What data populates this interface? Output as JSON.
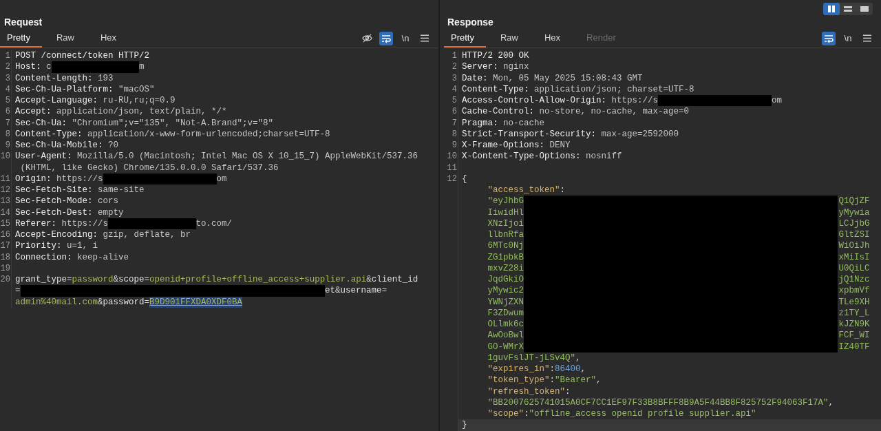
{
  "panels": [
    {
      "title": "Request",
      "tabs": [
        {
          "label": "Pretty",
          "selected": true,
          "disabled": false
        },
        {
          "label": "Raw",
          "selected": false,
          "disabled": false
        },
        {
          "label": "Hex",
          "selected": false,
          "disabled": false
        }
      ],
      "toolbar": [
        {
          "kind": "hide",
          "active": false
        },
        {
          "kind": "wrap",
          "active": true
        },
        {
          "kind": "newline",
          "label": "\\n",
          "active": false
        },
        {
          "kind": "menu",
          "active": false
        }
      ],
      "lines": [
        {
          "n": "1",
          "rows": [
            {
              "current": false,
              "indent": false,
              "segs": [
                {
                  "kind": "start",
                  "text": "POST /connect/token HTTP/2"
                }
              ]
            }
          ]
        },
        {
          "n": "2",
          "rows": [
            {
              "current": false,
              "indent": false,
              "segs": [
                {
                  "kind": "name",
                  "text": "Host: "
                },
                {
                  "kind": "val",
                  "text": "c"
                },
                {
                  "kind": "redacted"
                },
                {
                  "kind": "val",
                  "text": "m"
                }
              ]
            }
          ]
        },
        {
          "n": "3",
          "rows": [
            {
              "current": false,
              "indent": false,
              "segs": [
                {
                  "kind": "name",
                  "text": "Content-Length: "
                },
                {
                  "kind": "val",
                  "text": "193"
                }
              ]
            }
          ]
        },
        {
          "n": "4",
          "rows": [
            {
              "current": false,
              "indent": false,
              "segs": [
                {
                  "kind": "name",
                  "text": "Sec-Ch-Ua-Platform: "
                },
                {
                  "kind": "val",
                  "text": "\"macOS\""
                }
              ]
            }
          ]
        },
        {
          "n": "5",
          "rows": [
            {
              "current": false,
              "indent": false,
              "segs": [
                {
                  "kind": "name",
                  "text": "Accept-Language: "
                },
                {
                  "kind": "val",
                  "text": "ru-RU,ru;q=0.9"
                }
              ]
            }
          ]
        },
        {
          "n": "6",
          "rows": [
            {
              "current": false,
              "indent": false,
              "segs": [
                {
                  "kind": "name",
                  "text": "Accept: "
                },
                {
                  "kind": "val",
                  "text": "application/json, text/plain, */*"
                }
              ]
            }
          ]
        },
        {
          "n": "7",
          "rows": [
            {
              "current": false,
              "indent": false,
              "segs": [
                {
                  "kind": "name",
                  "text": "Sec-Ch-Ua: "
                },
                {
                  "kind": "val",
                  "text": "\"Chromium\";v=\"135\", \"Not-A.Brand\";v=\"8\""
                }
              ]
            }
          ]
        },
        {
          "n": "8",
          "rows": [
            {
              "current": false,
              "indent": false,
              "segs": [
                {
                  "kind": "name",
                  "text": "Content-Type: "
                },
                {
                  "kind": "val",
                  "text": "application/x-www-form-urlencoded;charset=UTF-8"
                }
              ]
            }
          ]
        },
        {
          "n": "9",
          "rows": [
            {
              "current": false,
              "indent": false,
              "segs": [
                {
                  "kind": "name",
                  "text": "Sec-Ch-Ua-Mobile: "
                },
                {
                  "kind": "val",
                  "text": "?0"
                }
              ]
            }
          ]
        },
        {
          "n": "10",
          "rows": [
            {
              "current": false,
              "indent": false,
              "segs": [
                {
                  "kind": "name",
                  "text": "User-Agent: "
                },
                {
                  "kind": "val",
                  "text": "Mozilla/5.0 (Macintosh; Intel Mac OS X 10_15_7) AppleWebKit/537.36"
                }
              ]
            },
            {
              "current": false,
              "indent": false,
              "segs": [
                {
                  "kind": "val",
                  "text": " (KHTML, like Gecko) Chrome/135.0.0.0 Safari/537.36"
                }
              ]
            }
          ]
        },
        {
          "n": "11",
          "rows": [
            {
              "current": false,
              "indent": false,
              "segs": [
                {
                  "kind": "name",
                  "text": "Origin: "
                },
                {
                  "kind": "val",
                  "text": "https://s"
                },
                {
                  "kind": "redacted"
                },
                {
                  "kind": "val",
                  "text": "om"
                }
              ]
            }
          ]
        },
        {
          "n": "12",
          "rows": [
            {
              "current": false,
              "indent": false,
              "segs": [
                {
                  "kind": "name",
                  "text": "Sec-Fetch-Site: "
                },
                {
                  "kind": "val",
                  "text": "same-site"
                }
              ]
            }
          ]
        },
        {
          "n": "13",
          "rows": [
            {
              "current": false,
              "indent": false,
              "segs": [
                {
                  "kind": "name",
                  "text": "Sec-Fetch-Mode: "
                },
                {
                  "kind": "val",
                  "text": "cors"
                }
              ]
            }
          ]
        },
        {
          "n": "14",
          "rows": [
            {
              "current": false,
              "indent": false,
              "segs": [
                {
                  "kind": "name",
                  "text": "Sec-Fetch-Dest: "
                },
                {
                  "kind": "val",
                  "text": "empty"
                }
              ]
            }
          ]
        },
        {
          "n": "15",
          "rows": [
            {
              "current": false,
              "indent": false,
              "segs": [
                {
                  "kind": "name",
                  "text": "Referer: "
                },
                {
                  "kind": "val",
                  "text": "https://s"
                },
                {
                  "kind": "redacted"
                },
                {
                  "kind": "val",
                  "text": "to.com/"
                }
              ]
            }
          ]
        },
        {
          "n": "16",
          "rows": [
            {
              "current": false,
              "indent": false,
              "segs": [
                {
                  "kind": "name",
                  "text": "Accept-Encoding: "
                },
                {
                  "kind": "val",
                  "text": "gzip, deflate, br"
                }
              ]
            }
          ]
        },
        {
          "n": "17",
          "rows": [
            {
              "current": false,
              "indent": false,
              "segs": [
                {
                  "kind": "name",
                  "text": "Priority: "
                },
                {
                  "kind": "val",
                  "text": "u=1, i"
                }
              ]
            }
          ]
        },
        {
          "n": "18",
          "rows": [
            {
              "current": false,
              "indent": false,
              "segs": [
                {
                  "kind": "name",
                  "text": "Connection: "
                },
                {
                  "kind": "val",
                  "text": "keep-alive"
                }
              ]
            }
          ]
        },
        {
          "n": "19"
        },
        {
          "n": "20",
          "rows": [
            {
              "current": false,
              "indent": false,
              "segs": [
                {
                  "kind": "key",
                  "text": "grant_type"
                },
                {
                  "kind": "punct",
                  "text": "="
                },
                {
                  "kind": "pval",
                  "text": "password"
                },
                {
                  "kind": "punct",
                  "text": "&"
                },
                {
                  "kind": "key",
                  "text": "scope"
                },
                {
                  "kind": "punct",
                  "text": "="
                },
                {
                  "kind": "pval",
                  "text": "openid+profile+offline_access+supplier.api"
                },
                {
                  "kind": "punct",
                  "text": "&"
                },
                {
                  "kind": "key",
                  "text": "client_id"
                }
              ]
            },
            {
              "current": false,
              "indent": false,
              "segs": [
                {
                  "kind": "punct",
                  "text": "="
                },
                {
                  "kind": "redacted"
                },
                {
                  "kind": "key",
                  "text": "et"
                },
                {
                  "kind": "punct",
                  "text": "&"
                },
                {
                  "kind": "key",
                  "text": "username"
                },
                {
                  "kind": "punct",
                  "text": "="
                }
              ]
            },
            {
              "current": false,
              "indent": false,
              "segs": [
                {
                  "kind": "pval",
                  "text": "admin%40mail.com"
                },
                {
                  "kind": "punct",
                  "text": "&"
                },
                {
                  "kind": "key",
                  "text": "password"
                },
                {
                  "kind": "punct",
                  "text": "="
                },
                {
                  "kind": "sel",
                  "text": "B9D901FFXDA0XDF0BA"
                }
              ]
            }
          ]
        }
      ]
    },
    {
      "title": "Response",
      "layout_toggles": [
        {
          "kind": "columns",
          "selected": true
        },
        {
          "kind": "rows",
          "selected": false
        },
        {
          "kind": "single",
          "selected": false
        }
      ],
      "tabs": [
        {
          "label": "Pretty",
          "selected": true,
          "disabled": false
        },
        {
          "label": "Raw",
          "selected": false,
          "disabled": false
        },
        {
          "label": "Hex",
          "selected": false,
          "disabled": false
        },
        {
          "label": "Render",
          "selected": false,
          "disabled": true
        }
      ],
      "toolbar": [
        {
          "kind": "wrap",
          "active": true
        },
        {
          "kind": "newline",
          "label": "\\n",
          "active": false
        },
        {
          "kind": "menu",
          "active": false
        }
      ],
      "lines": [
        {
          "n": "1",
          "rows": [
            {
              "current": false,
              "indent": false,
              "segs": [
                {
                  "kind": "start",
                  "text": "HTTP/2 200 OK"
                }
              ]
            }
          ]
        },
        {
          "n": "2",
          "rows": [
            {
              "current": false,
              "indent": false,
              "segs": [
                {
                  "kind": "name",
                  "text": "Server: "
                },
                {
                  "kind": "val",
                  "text": "nginx"
                }
              ]
            }
          ]
        },
        {
          "n": "3",
          "rows": [
            {
              "current": false,
              "indent": false,
              "segs": [
                {
                  "kind": "name",
                  "text": "Date: "
                },
                {
                  "kind": "val",
                  "text": "Mon, 05 May 2025 15:08:43 GMT"
                }
              ]
            }
          ]
        },
        {
          "n": "4",
          "rows": [
            {
              "current": false,
              "indent": false,
              "segs": [
                {
                  "kind": "name",
                  "text": "Content-Type: "
                },
                {
                  "kind": "val",
                  "text": "application/json; charset=UTF-8"
                }
              ]
            }
          ]
        },
        {
          "n": "5",
          "rows": [
            {
              "current": false,
              "indent": false,
              "segs": [
                {
                  "kind": "name",
                  "text": "Access-Control-Allow-Origin: "
                },
                {
                  "kind": "val",
                  "text": "https://s"
                },
                {
                  "kind": "redacted"
                },
                {
                  "kind": "val",
                  "text": "om"
                }
              ]
            }
          ]
        },
        {
          "n": "6",
          "rows": [
            {
              "current": false,
              "indent": false,
              "segs": [
                {
                  "kind": "name",
                  "text": "Cache-Control: "
                },
                {
                  "kind": "val",
                  "text": "no-store, no-cache, max-age=0"
                }
              ]
            }
          ]
        },
        {
          "n": "7",
          "rows": [
            {
              "current": false,
              "indent": false,
              "segs": [
                {
                  "kind": "name",
                  "text": "Pragma: "
                },
                {
                  "kind": "val",
                  "text": "no-cache"
                }
              ]
            }
          ]
        },
        {
          "n": "8",
          "rows": [
            {
              "current": false,
              "indent": false,
              "segs": [
                {
                  "kind": "name",
                  "text": "Strict-Transport-Security: "
                },
                {
                  "kind": "val",
                  "text": "max-age=2592000"
                }
              ]
            }
          ]
        },
        {
          "n": "9",
          "rows": [
            {
              "current": false,
              "indent": false,
              "segs": [
                {
                  "kind": "name",
                  "text": "X-Frame-Options: "
                },
                {
                  "kind": "val",
                  "text": "DENY"
                }
              ]
            }
          ]
        },
        {
          "n": "10",
          "rows": [
            {
              "current": false,
              "indent": false,
              "segs": [
                {
                  "kind": "name",
                  "text": "X-Content-Type-Options: "
                },
                {
                  "kind": "val",
                  "text": "nosniff"
                }
              ]
            }
          ]
        },
        {
          "n": "11"
        },
        {
          "n": "12",
          "mask": true,
          "rows": [
            {
              "current": false,
              "indent": false,
              "segs": [
                {
                  "kind": "punct",
                  "text": "{"
                }
              ]
            },
            {
              "current": false,
              "indent": true,
              "segs": [
                {
                  "kind": "jkey",
                  "text": "\"access_token\""
                },
                {
                  "kind": "punct",
                  "text": ":"
                }
              ]
            },
            {
              "current": false,
              "indent": true,
              "segs": [
                {
                  "kind": "jstr",
                  "text": "\"eyJhbG"
                },
                {
                  "kind": "gap"
                },
                {
                  "kind": "jstr",
                  "text": "Q1QjZF"
                }
              ]
            },
            {
              "current": false,
              "indent": true,
              "segs": [
                {
                  "kind": "jstr",
                  "text": "IiwidHl"
                },
                {
                  "kind": "gap"
                },
                {
                  "kind": "jstr",
                  "text": "yMywia"
                }
              ]
            },
            {
              "current": false,
              "indent": true,
              "segs": [
                {
                  "kind": "jstr",
                  "text": "XNzIjoi"
                },
                {
                  "kind": "gap"
                },
                {
                  "kind": "jstr",
                  "text": "LCJjbG"
                }
              ]
            },
            {
              "current": false,
              "indent": true,
              "segs": [
                {
                  "kind": "jstr",
                  "text": "llbnRfa"
                },
                {
                  "kind": "gap"
                },
                {
                  "kind": "jstr",
                  "text": "GltZSI"
                }
              ]
            },
            {
              "current": false,
              "indent": true,
              "segs": [
                {
                  "kind": "jstr",
                  "text": "6MTc0Nj"
                },
                {
                  "kind": "gap"
                },
                {
                  "kind": "jstr",
                  "text": "WiOiJh"
                }
              ]
            },
            {
              "current": false,
              "indent": true,
              "segs": [
                {
                  "kind": "jstr",
                  "text": "ZG1pbkB"
                },
                {
                  "kind": "gap"
                },
                {
                  "kind": "jstr",
                  "text": "xMiIsI"
                }
              ]
            },
            {
              "current": false,
              "indent": true,
              "segs": [
                {
                  "kind": "jstr",
                  "text": "mxvZ28i"
                },
                {
                  "kind": "gap"
                },
                {
                  "kind": "jstr",
                  "text": "U0QiLC"
                }
              ]
            },
            {
              "current": false,
              "indent": true,
              "segs": [
                {
                  "kind": "jstr",
                  "text": "JqdGkiO"
                },
                {
                  "kind": "gap"
                },
                {
                  "kind": "jstr",
                  "text": "jQ1Nzc"
                }
              ]
            },
            {
              "current": false,
              "indent": true,
              "segs": [
                {
                  "kind": "jstr",
                  "text": "yMywic2"
                },
                {
                  "kind": "gap"
                },
                {
                  "kind": "jstr",
                  "text": "xpbmVf"
                }
              ]
            },
            {
              "current": false,
              "indent": true,
              "segs": [
                {
                  "kind": "jstr",
                  "text": "YWNjZXN"
                },
                {
                  "kind": "gap"
                },
                {
                  "kind": "jstr",
                  "text": "TLe9XH"
                }
              ]
            },
            {
              "current": false,
              "indent": true,
              "segs": [
                {
                  "kind": "jstr",
                  "text": "F3ZDwum"
                },
                {
                  "kind": "gap"
                },
                {
                  "kind": "jstr",
                  "text": "z1TY_L"
                }
              ]
            },
            {
              "current": false,
              "indent": true,
              "segs": [
                {
                  "kind": "jstr",
                  "text": "OLlmk6c"
                },
                {
                  "kind": "gap"
                },
                {
                  "kind": "jstr",
                  "text": "kJZN9K"
                }
              ]
            },
            {
              "current": false,
              "indent": true,
              "segs": [
                {
                  "kind": "jstr",
                  "text": "AwOoBwl"
                },
                {
                  "kind": "gap"
                },
                {
                  "kind": "jstr",
                  "text": "FCF_WI"
                }
              ]
            },
            {
              "current": false,
              "indent": true,
              "segs": [
                {
                  "kind": "jstr",
                  "text": "GO-WMrX"
                },
                {
                  "kind": "gap"
                },
                {
                  "kind": "jstr",
                  "text": "IZ40TF"
                }
              ]
            },
            {
              "current": false,
              "indent": true,
              "segs": [
                {
                  "kind": "jstr",
                  "text": "1guvFslJT-jLSv4Q\""
                },
                {
                  "kind": "punct",
                  "text": ","
                }
              ]
            },
            {
              "current": false,
              "indent": true,
              "segs": [
                {
                  "kind": "jkey",
                  "text": "\"expires_in\""
                },
                {
                  "kind": "punct",
                  "text": ":"
                },
                {
                  "kind": "jnum",
                  "text": "86400"
                },
                {
                  "kind": "punct",
                  "text": ","
                }
              ]
            },
            {
              "current": false,
              "indent": true,
              "segs": [
                {
                  "kind": "jkey",
                  "text": "\"token_type\""
                },
                {
                  "kind": "punct",
                  "text": ":"
                },
                {
                  "kind": "jstr",
                  "text": "\"Bearer\""
                },
                {
                  "kind": "punct",
                  "text": ","
                }
              ]
            },
            {
              "current": false,
              "indent": true,
              "segs": [
                {
                  "kind": "jkey",
                  "text": "\"refresh_token\""
                },
                {
                  "kind": "punct",
                  "text": ":"
                }
              ]
            },
            {
              "current": false,
              "indent": true,
              "segs": [
                {
                  "kind": "jstr",
                  "text": "\"BB2007625741015A0CF7CC1EF97F33B8BFFF8B9A5F44BB8F825752F94063F17A\""
                },
                {
                  "kind": "punct",
                  "text": ","
                }
              ]
            },
            {
              "current": false,
              "indent": true,
              "segs": [
                {
                  "kind": "jkey",
                  "text": "\"scope\""
                },
                {
                  "kind": "punct",
                  "text": ":"
                },
                {
                  "kind": "jstr",
                  "text": "\"offline_access openid profile supplier.api\""
                }
              ]
            },
            {
              "current": true,
              "indent": false,
              "segs": [
                {
                  "kind": "punct",
                  "text": "}"
                }
              ]
            }
          ]
        }
      ]
    }
  ]
}
